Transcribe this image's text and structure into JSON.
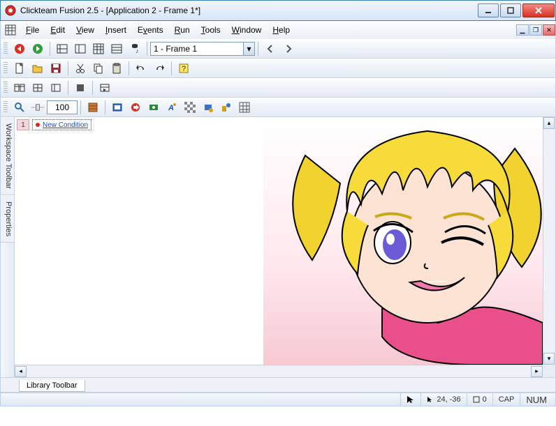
{
  "window": {
    "title": "Clickteam Fusion 2.5 - [Application 2 - Frame 1*]"
  },
  "menu": {
    "file": "File",
    "edit": "Edit",
    "view": "View",
    "insert": "Insert",
    "events": "Events",
    "run": "Run",
    "tools": "Tools",
    "window": "Window",
    "help": "Help"
  },
  "toolbar1": {
    "frame_combo": "1 - Frame 1"
  },
  "zoom": {
    "value": "100"
  },
  "side": {
    "workspace": "Workspace Toolbar",
    "properties": "Properties"
  },
  "eventEditor": {
    "row1_num": "1",
    "row1_cond": "New Condition"
  },
  "bottom": {
    "library_tab": "Library Toolbar"
  },
  "status": {
    "cursor_icon": "▸",
    "coords": "24, -36",
    "frame_icon": "▫",
    "frame_num": "0",
    "cap": "CAP",
    "num": "NUM"
  }
}
